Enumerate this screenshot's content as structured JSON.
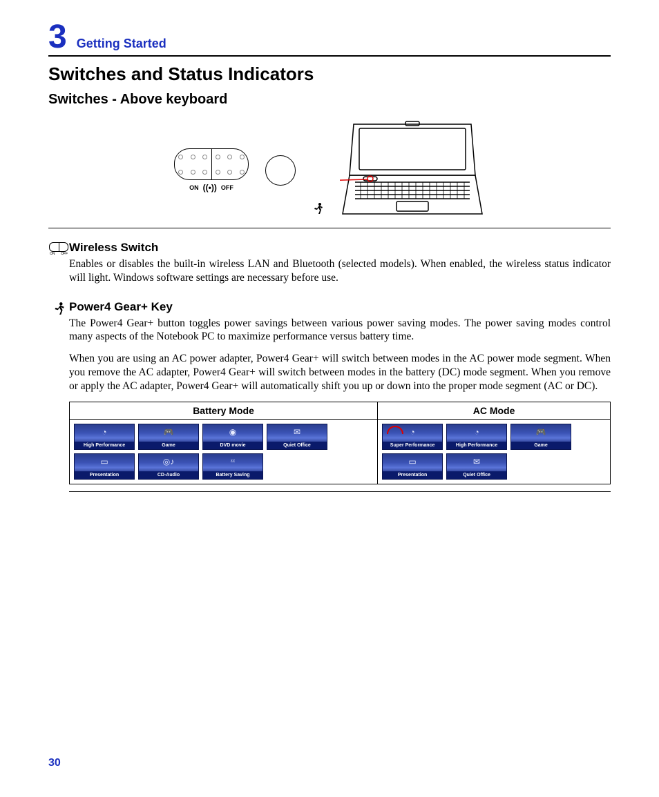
{
  "chapter": {
    "number": "3",
    "title": "Getting Started"
  },
  "section_title": "Switches and Status Indicators",
  "subsection_title": "Switches - Above keyboard",
  "switch_diagram": {
    "on": "ON",
    "off": "OFF"
  },
  "wireless": {
    "title": "Wireless Switch",
    "body": "Enables or disables the built-in wireless LAN and Bluetooth (selected models). When enabled, the wireless status indicator will light. Windows software settings are necessary before use."
  },
  "power4": {
    "title": "Power4 Gear+ Key",
    "p1": "The Power4 Gear+ button toggles power savings between various power saving modes. The power saving modes control many aspects of the Notebook PC to maximize performance versus battery time.",
    "p2": "When you are using an AC power adapter, Power4 Gear+ will switch between modes in the AC power mode segment. When you remove the AC adapter, Power4 Gear+ will switch between modes in the battery (DC) mode segment. When you remove or apply the AC adapter, Power4 Gear+ will automatically shift you up or down into the proper mode segment (AC or DC)."
  },
  "mode_table": {
    "battery_header": "Battery Mode",
    "ac_header": "AC Mode",
    "battery_tiles": [
      "High Performance",
      "Game",
      "DVD movie",
      "Quiet Office",
      "Presentation",
      "CD-Audio",
      "Battery Saving"
    ],
    "ac_tiles": [
      "Super Performance",
      "High Performance",
      "Game",
      "Presentation",
      "Quiet Office"
    ]
  },
  "page_number": "30"
}
